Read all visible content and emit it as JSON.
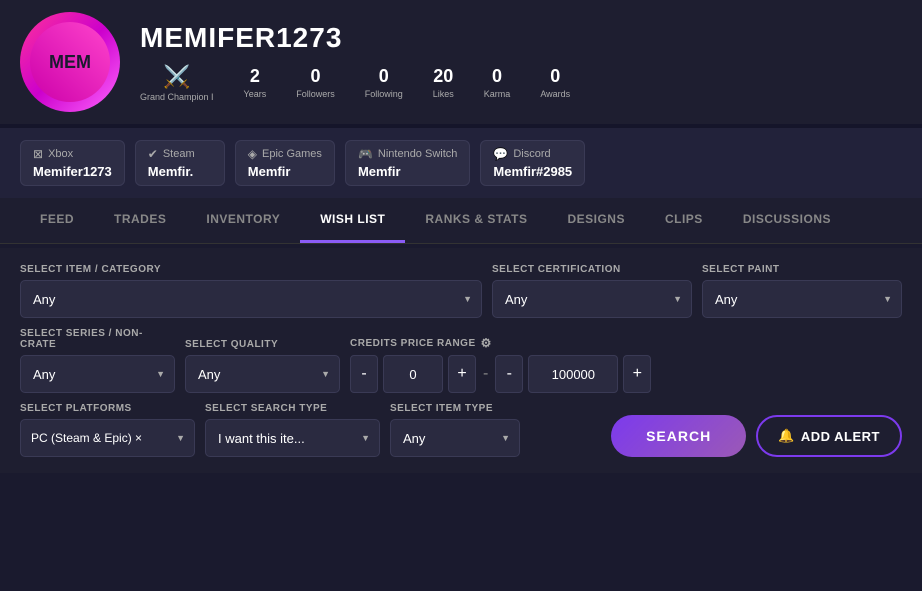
{
  "profile": {
    "username": "MEMIFER1273",
    "rank": {
      "title": "Grand Champion I",
      "icon": "🔴"
    },
    "stats": [
      {
        "value": "2",
        "label": "Years"
      },
      {
        "value": "0",
        "label": "Followers"
      },
      {
        "value": "0",
        "label": "Following"
      },
      {
        "value": "20",
        "label": "Likes"
      },
      {
        "value": "0",
        "label": "Karma"
      },
      {
        "value": "0",
        "label": "Awards"
      }
    ]
  },
  "platforms": [
    {
      "name": "Xbox",
      "icon": "⊠",
      "username": "Memifer1273"
    },
    {
      "name": "Steam",
      "icon": "♨",
      "username": "Memfir."
    },
    {
      "name": "Epic Games",
      "icon": "⬡",
      "username": "Memfir"
    },
    {
      "name": "Nintendo Switch",
      "icon": "🎮",
      "username": "Memfir"
    },
    {
      "name": "Discord",
      "icon": "💬",
      "username": "Memfir#2985"
    }
  ],
  "nav": {
    "tabs": [
      {
        "label": "FEED",
        "active": false
      },
      {
        "label": "TRADES",
        "active": false
      },
      {
        "label": "INVENTORY",
        "active": false
      },
      {
        "label": "WISH LIST",
        "active": true
      },
      {
        "label": "RANKS & STATS",
        "active": false
      },
      {
        "label": "DESIGNS",
        "active": false
      },
      {
        "label": "CLIPS",
        "active": false
      },
      {
        "label": "DISCUSSIONS",
        "active": false
      }
    ]
  },
  "filters": {
    "item_category": {
      "label": "SELECT ITEM / CATEGORY",
      "value": "Any"
    },
    "certification": {
      "label": "SELECT CERTIFICATION",
      "value": "Any"
    },
    "paint": {
      "label": "SELECT PAINT",
      "value": "Any"
    },
    "series": {
      "label": "SELECT SERIES / NON-CRATE",
      "value": "Any"
    },
    "quality": {
      "label": "SELECT QUALITY",
      "value": "Any"
    },
    "credits_price_range": {
      "label": "CREDITS PRICE RANGE",
      "min_value": "0",
      "max_value": "100000"
    },
    "platforms": {
      "label": "SELECT PLATFORMS",
      "value": "PC (Steam & Epic)",
      "has_remove": true
    },
    "search_type": {
      "label": "SELECT SEARCH TYPE",
      "value": "I want this ite..."
    },
    "item_type": {
      "label": "SELECT ITEM TYPE",
      "value": "Any"
    },
    "search_button": "SEARCH",
    "alert_button": "ADD ALERT"
  }
}
